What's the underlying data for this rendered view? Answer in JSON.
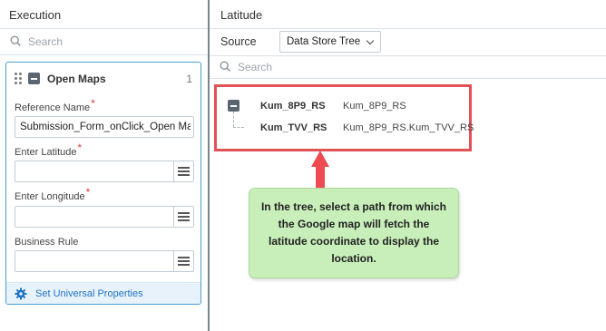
{
  "left": {
    "title": "Execution",
    "search_placeholder": "Search",
    "card": {
      "title": "Open Maps",
      "count": "1",
      "fields": [
        {
          "label": "Reference Name",
          "required": true,
          "value": "Submission_Form_onClick_Open Maps"
        },
        {
          "label": "Enter Latitude",
          "required": true,
          "value": ""
        },
        {
          "label": "Enter Longitude",
          "required": true,
          "value": ""
        },
        {
          "label": "Business Rule",
          "required": false,
          "value": ""
        }
      ],
      "required_mark": "*",
      "footer_link": "Set Universal Properties"
    }
  },
  "right": {
    "title": "Latitude",
    "source_label": "Source",
    "source_value": "Data Store Tree",
    "search_placeholder": "Search",
    "tree": [
      {
        "name": "Kum_8P9_RS",
        "path": "Kum_8P9_RS"
      },
      {
        "name": "Kum_TVV_RS",
        "path": "Kum_8P9_RS.Kum_TVV_RS"
      }
    ]
  },
  "annotation": {
    "text": "In the tree, select a path from which the Google map will fetch the latitude coordinate to display the location.",
    "highlight_color": "#e05256",
    "callout_color": "#c8efba"
  }
}
